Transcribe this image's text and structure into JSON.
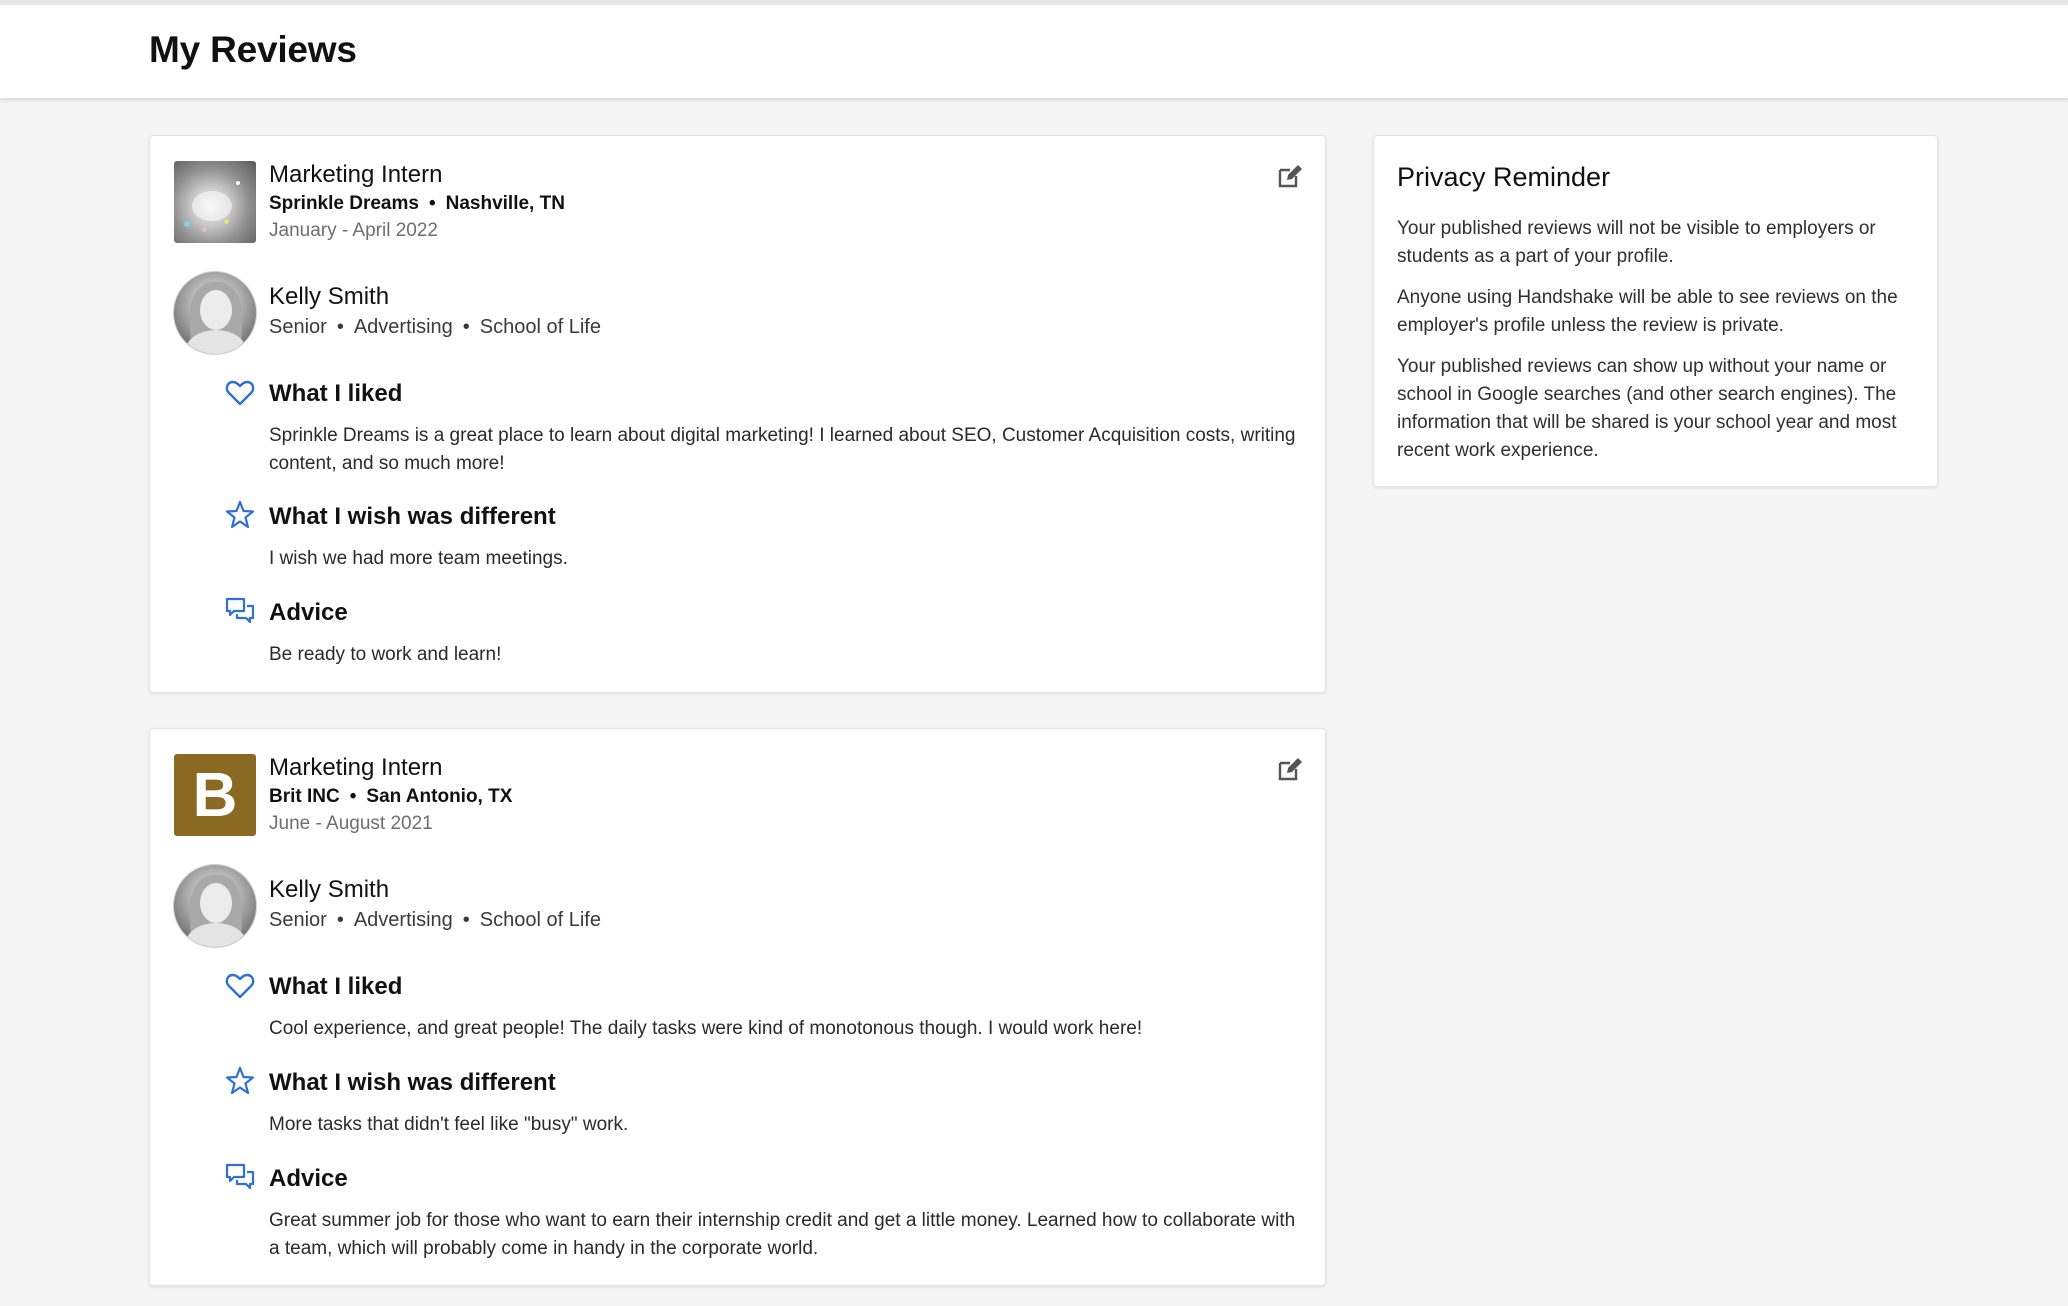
{
  "page": {
    "title": "My Reviews"
  },
  "reviews": [
    {
      "logo_type": "image",
      "job_title": "Marketing Intern",
      "employer": "Sprinkle Dreams",
      "location": "Nashville, TN",
      "dates": "January - April 2022",
      "reviewer": {
        "name": "Kelly Smith",
        "year": "Senior",
        "major": "Advertising",
        "school": "School of Life"
      },
      "sections": [
        {
          "icon": "heart-icon",
          "heading": "What I liked",
          "body": "Sprinkle Dreams is a great place to learn about digital marketing! I learned about SEO, Customer Acquisition costs, writing content, and so much more!"
        },
        {
          "icon": "star-icon",
          "heading": "What I wish was different",
          "body": "I wish we had more team meetings."
        },
        {
          "icon": "chat-bubbles-icon",
          "heading": "Advice",
          "body": "Be ready to work and learn!"
        }
      ]
    },
    {
      "logo_type": "letter",
      "logo_letter": "B",
      "logo_color": "#8a6a22",
      "job_title": "Marketing Intern",
      "employer": "Brit INC",
      "location": "San Antonio, TX",
      "dates": "June - August 2021",
      "reviewer": {
        "name": "Kelly Smith",
        "year": "Senior",
        "major": "Advertising",
        "school": "School of Life"
      },
      "sections": [
        {
          "icon": "heart-icon",
          "heading": "What I liked",
          "body": "Cool experience, and great people! The daily tasks were kind of monotonous though. I would work here!"
        },
        {
          "icon": "star-icon",
          "heading": "What I wish was different",
          "body": "More tasks that didn't feel like \"busy\" work."
        },
        {
          "icon": "chat-bubbles-icon",
          "heading": "Advice",
          "body": "Great summer job for those who want to earn their internship credit and get a little money. Learned how to collaborate with a team, which will probably come in handy in the corporate world."
        }
      ]
    }
  ],
  "privacy": {
    "title": "Privacy Reminder",
    "paragraphs": [
      "Your published reviews will not be visible to employers or students as a part of your profile.",
      "Anyone using Handshake will be able to see reviews on the employer's profile unless the review is private.",
      "Your published reviews can show up without your name or school in Google searches (and other search engines). The information that will be shared is your school year and most recent work experience."
    ]
  },
  "colors": {
    "accent_icon": "#2f6fd6",
    "edit_icon": "#555555"
  },
  "separator": "•"
}
